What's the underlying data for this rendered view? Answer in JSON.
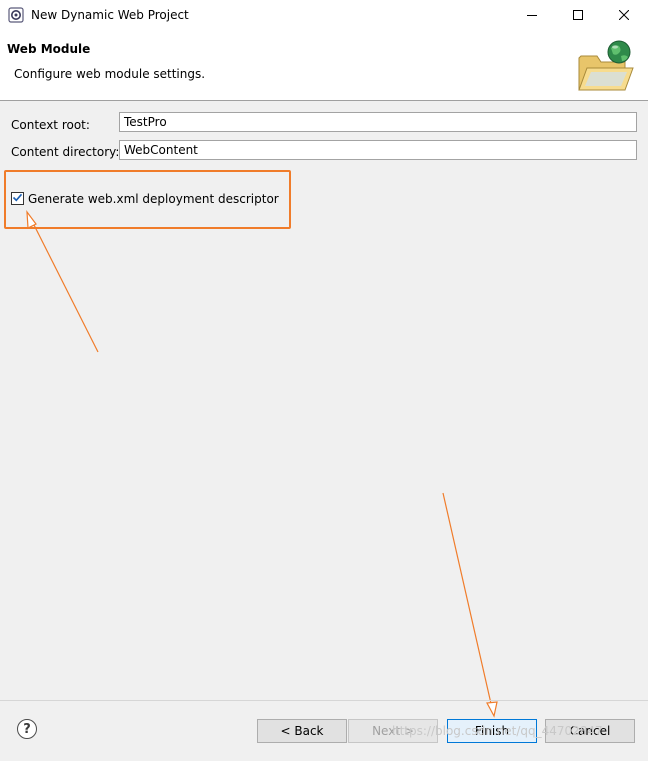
{
  "window": {
    "title": "New Dynamic Web Project",
    "controls": [
      "minimize-icon",
      "maximize-icon",
      "close-icon"
    ]
  },
  "header": {
    "title": "Web Module",
    "description": "Configure web module settings.",
    "icon": "web-folder-globe-icon"
  },
  "form": {
    "context_root": {
      "label": "Context root:",
      "value": "TestPro"
    },
    "content_directory": {
      "label": "Content directory:",
      "value": "WebContent"
    },
    "generate_descriptor": {
      "label": "Generate web.xml deployment descriptor",
      "checked": true
    }
  },
  "buttons": {
    "help_glyph": "?",
    "back": "< Back",
    "next": "Next >",
    "finish": "Finish",
    "cancel": "Cancel"
  },
  "watermark": "https://blog.csdn.net/qq_44702847",
  "colors": {
    "annotation": "#f07c2a",
    "default_button_border": "#0078d7"
  }
}
